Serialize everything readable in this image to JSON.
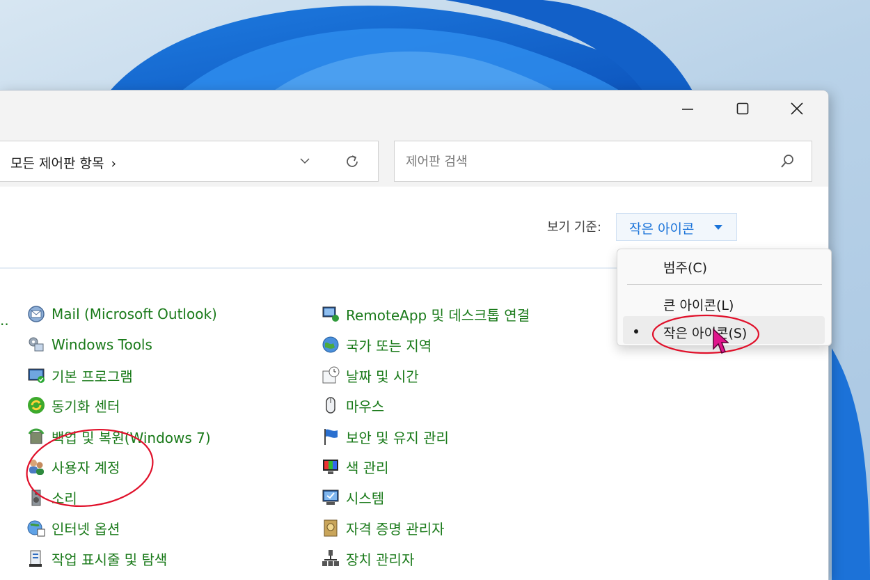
{
  "window": {
    "address_crumb": "모든 제어판 항목",
    "address_sep": "›",
    "search_placeholder": "제어판 검색"
  },
  "view": {
    "label": "보기 기준:",
    "current": "작은 아이콘"
  },
  "menu": {
    "items": [
      {
        "label": "범주(C)"
      },
      {
        "label": "큰 아이콘(L)"
      },
      {
        "label": "작은 아이콘(S)",
        "selected": true
      }
    ]
  },
  "left_overflow_text": "..",
  "items_col1": [
    {
      "label": "Mail (Microsoft Outlook)",
      "icon": "mail-icon"
    },
    {
      "label": "Windows Tools",
      "icon": "tools-icon"
    },
    {
      "label": "기본 프로그램",
      "icon": "default-programs-icon"
    },
    {
      "label": "동기화 센터",
      "icon": "sync-center-icon"
    },
    {
      "label": "백업 및 복원(Windows 7)",
      "icon": "backup-icon"
    },
    {
      "label": "사용자 계정",
      "icon": "user-accounts-icon"
    },
    {
      "label": "소리",
      "icon": "sound-icon"
    },
    {
      "label": "인터넷 옵션",
      "icon": "internet-options-icon"
    },
    {
      "label": "작업 표시줄 및 탐색",
      "icon": "taskbar-icon"
    }
  ],
  "items_col2": [
    {
      "label": "RemoteApp 및 데스크톱 연결",
      "icon": "remoteapp-icon"
    },
    {
      "label": "국가 또는 지역",
      "icon": "region-icon"
    },
    {
      "label": "날짜 및 시간",
      "icon": "date-time-icon"
    },
    {
      "label": "마우스",
      "icon": "mouse-icon"
    },
    {
      "label": "보안 및 유지 관리",
      "icon": "security-flag-icon"
    },
    {
      "label": "색 관리",
      "icon": "color-management-icon"
    },
    {
      "label": "시스템",
      "icon": "system-icon"
    },
    {
      "label": "자격 증명 관리자",
      "icon": "credential-manager-icon"
    },
    {
      "label": "장치 관리자",
      "icon": "device-manager-icon"
    }
  ],
  "colors": {
    "link_green": "#1a7a1a",
    "accent_blue": "#1a73d9",
    "annotation_red": "#e0102a"
  }
}
